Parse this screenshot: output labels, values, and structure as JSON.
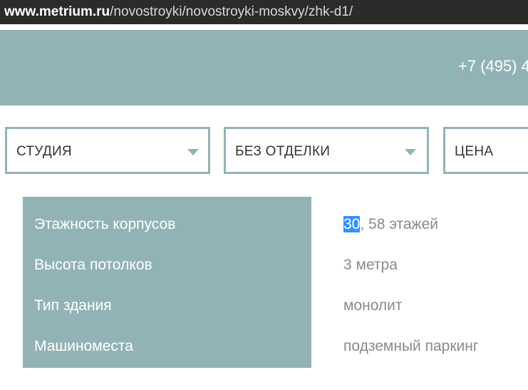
{
  "browser": {
    "url_domain": "www.metrium.ru",
    "url_path": "/novostroyki/novostroyki-moskvy/zhk-d1/"
  },
  "header": {
    "phone": "+7 (495) 4"
  },
  "filters": [
    {
      "label": "СТУДИЯ"
    },
    {
      "label": "БЕЗ ОТДЕЛКИ"
    },
    {
      "label": "ЦЕНА"
    }
  ],
  "specs": [
    {
      "label": "Этажность корпусов",
      "value_selected": "30",
      "value_rest": ", 58 этажей"
    },
    {
      "label": "Высота потолков",
      "value": "3 метра"
    },
    {
      "label": "Тип здания",
      "value": "монолит"
    },
    {
      "label": "Машиноместа",
      "value": "подземный паркинг"
    }
  ],
  "colors": {
    "accent": "#92b3b5",
    "selection": "#3390ff",
    "value_text": "#8a8a8a"
  }
}
